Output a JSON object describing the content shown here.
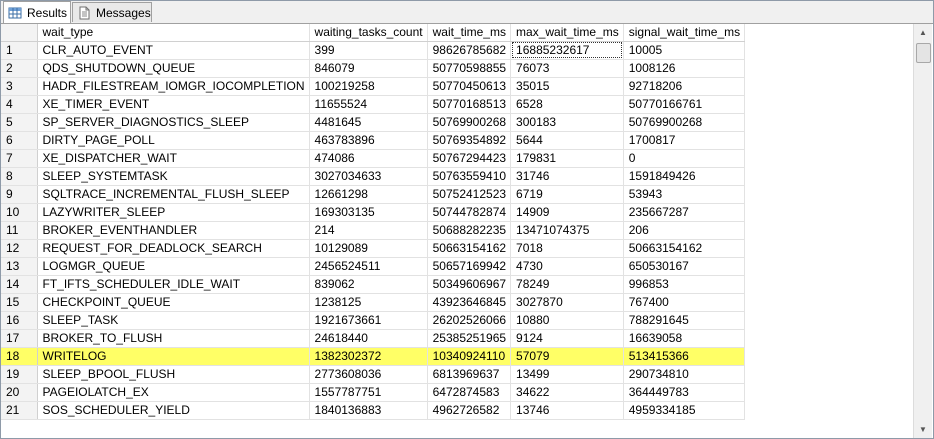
{
  "tabs": [
    {
      "label": "Results",
      "icon": "grid-icon",
      "active": true
    },
    {
      "label": "Messages",
      "icon": "document-icon",
      "active": false
    }
  ],
  "grid": {
    "columns": [
      "wait_type",
      "waiting_tasks_count",
      "wait_time_ms",
      "max_wait_time_ms",
      "signal_wait_time_ms"
    ],
    "rows": [
      {
        "n": "1",
        "cells": [
          "CLR_AUTO_EVENT",
          "399",
          "98626785682",
          "16885232617",
          "10005"
        ]
      },
      {
        "n": "2",
        "cells": [
          "QDS_SHUTDOWN_QUEUE",
          "846079",
          "50770598855",
          "76073",
          "1008126"
        ]
      },
      {
        "n": "3",
        "cells": [
          "HADR_FILESTREAM_IOMGR_IOCOMPLETION",
          "100219258",
          "50770450613",
          "35015",
          "92718206"
        ]
      },
      {
        "n": "4",
        "cells": [
          "XE_TIMER_EVENT",
          "11655524",
          "50770168513",
          "6528",
          "50770166761"
        ]
      },
      {
        "n": "5",
        "cells": [
          "SP_SERVER_DIAGNOSTICS_SLEEP",
          "4481645",
          "50769900268",
          "300183",
          "50769900268"
        ]
      },
      {
        "n": "6",
        "cells": [
          "DIRTY_PAGE_POLL",
          "463783896",
          "50769354892",
          "5644",
          "1700817"
        ]
      },
      {
        "n": "7",
        "cells": [
          "XE_DISPATCHER_WAIT",
          "474086",
          "50767294423",
          "179831",
          "0"
        ]
      },
      {
        "n": "8",
        "cells": [
          "SLEEP_SYSTEMTASK",
          "3027034633",
          "50763559410",
          "31746",
          "1591849426"
        ]
      },
      {
        "n": "9",
        "cells": [
          "SQLTRACE_INCREMENTAL_FLUSH_SLEEP",
          "12661298",
          "50752412523",
          "6719",
          "53943"
        ]
      },
      {
        "n": "10",
        "cells": [
          "LAZYWRITER_SLEEP",
          "169303135",
          "50744782874",
          "14909",
          "235667287"
        ]
      },
      {
        "n": "11",
        "cells": [
          "BROKER_EVENTHANDLER",
          "214",
          "50688282235",
          "13471074375",
          "206"
        ]
      },
      {
        "n": "12",
        "cells": [
          "REQUEST_FOR_DEADLOCK_SEARCH",
          "10129089",
          "50663154162",
          "7018",
          "50663154162"
        ]
      },
      {
        "n": "13",
        "cells": [
          "LOGMGR_QUEUE",
          "2456524511",
          "50657169942",
          "4730",
          "650530167"
        ]
      },
      {
        "n": "14",
        "cells": [
          "FT_IFTS_SCHEDULER_IDLE_WAIT",
          "839062",
          "50349606967",
          "78249",
          "996853"
        ]
      },
      {
        "n": "15",
        "cells": [
          "CHECKPOINT_QUEUE",
          "1238125",
          "43923646845",
          "3027870",
          "767400"
        ]
      },
      {
        "n": "16",
        "cells": [
          "SLEEP_TASK",
          "1921673661",
          "26202526066",
          "10880",
          "788291645"
        ]
      },
      {
        "n": "17",
        "cells": [
          "BROKER_TO_FLUSH",
          "24618440",
          "25385251965",
          "9124",
          "16639058"
        ]
      },
      {
        "n": "18",
        "cells": [
          "WRITELOG",
          "1382302372",
          "10340924110",
          "57079",
          "513415366"
        ],
        "highlight": true
      },
      {
        "n": "19",
        "cells": [
          "SLEEP_BPOOL_FLUSH",
          "2773608036",
          "6813969637",
          "13499",
          "290734810"
        ]
      },
      {
        "n": "20",
        "cells": [
          "PAGEIOLATCH_EX",
          "1557787751",
          "6472874583",
          "34622",
          "364449783"
        ]
      },
      {
        "n": "21",
        "cells": [
          "SOS_SCHEDULER_YIELD",
          "1840136883",
          "4962726582",
          "13746",
          "4959334185"
        ]
      }
    ]
  },
  "colors": {
    "highlight": "#ffff66",
    "header_bg": "#ffffff",
    "rownum_bg": "#f3f3f3"
  }
}
